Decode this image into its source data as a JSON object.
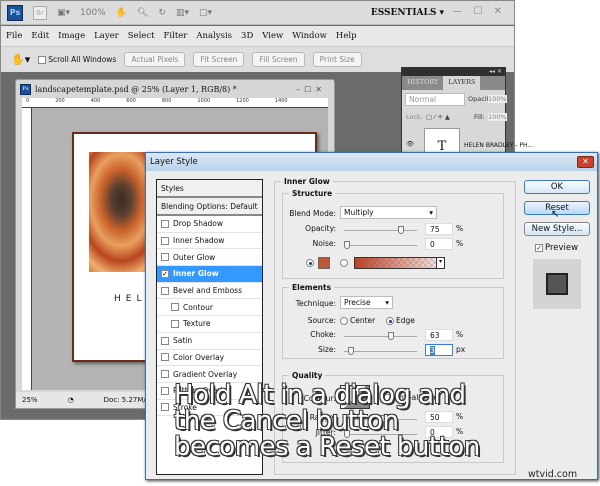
{
  "app": {
    "logo": "Ps",
    "bridge": "Br",
    "zoom": "100%",
    "workspace": "ESSENTIALS",
    "window_controls": "— ☐ ✕"
  },
  "menu": [
    "File",
    "Edit",
    "Image",
    "Layer",
    "Select",
    "Filter",
    "Analysis",
    "3D",
    "View",
    "Window",
    "Help"
  ],
  "options": {
    "scroll_all": "Scroll All Windows",
    "buttons": [
      "Actual Pixels",
      "Fit Screen",
      "Fill Screen",
      "Print Size"
    ]
  },
  "document": {
    "title": "landscapetemplate.psd @ 25% (Layer 1, RGB/8) *",
    "ruler": [
      "0",
      "200",
      "400",
      "600",
      "800",
      "1000",
      "1200",
      "1400"
    ],
    "page_text": "HELEN B",
    "zoom": "25%",
    "doc_size": "Doc: 5.27M/"
  },
  "layers_panel": {
    "tabs": [
      "HISTORY",
      "LAYERS"
    ],
    "blend": "Normal",
    "opacity_label": "Opacity:",
    "opacity": "100%",
    "lock_label": "Lock:",
    "fill_label": "Fill:",
    "fill": "100%",
    "layer_name": "HELEN BRADLEY - PH...",
    "layer_thumb": "T"
  },
  "dialog": {
    "title": "Layer Style",
    "styles": [
      "Styles",
      "Blending Options: Default",
      "Drop Shadow",
      "Inner Shadow",
      "Outer Glow",
      "Inner Glow",
      "Bevel and Emboss",
      "Contour",
      "Texture",
      "Satin",
      "Color Overlay",
      "Gradient Overlay",
      "Pattern Overlay",
      "Stroke"
    ],
    "section": "Inner Glow",
    "structure": {
      "title": "Structure",
      "blend_label": "Blend Mode:",
      "blend": "Multiply",
      "opacity_label": "Opacity:",
      "opacity": "75",
      "noise_label": "Noise:",
      "noise": "0",
      "pct": "%"
    },
    "elements": {
      "title": "Elements",
      "technique_label": "Technique:",
      "technique": "Precise",
      "source_label": "Source:",
      "center": "Center",
      "edge": "Edge",
      "choke_label": "Choke:",
      "choke": "63",
      "size_label": "Size:",
      "size": "3",
      "px": "px"
    },
    "quality": {
      "title": "Quality",
      "contour_label": "Contour:",
      "antialiased": "Anti-aliased",
      "range_label": "Range:",
      "range": "50",
      "jitter_label": "Jitter:",
      "jitter": "0"
    },
    "buttons": {
      "ok": "OK",
      "reset": "Reset",
      "new_style": "New Style...",
      "preview": "Preview"
    },
    "glow_color": "#c0553a"
  },
  "overlay_text": [
    "Hold Alt in a dialog and",
    "the Cancel button",
    "becomes a Reset button"
  ],
  "watermark": "wtvid.com"
}
